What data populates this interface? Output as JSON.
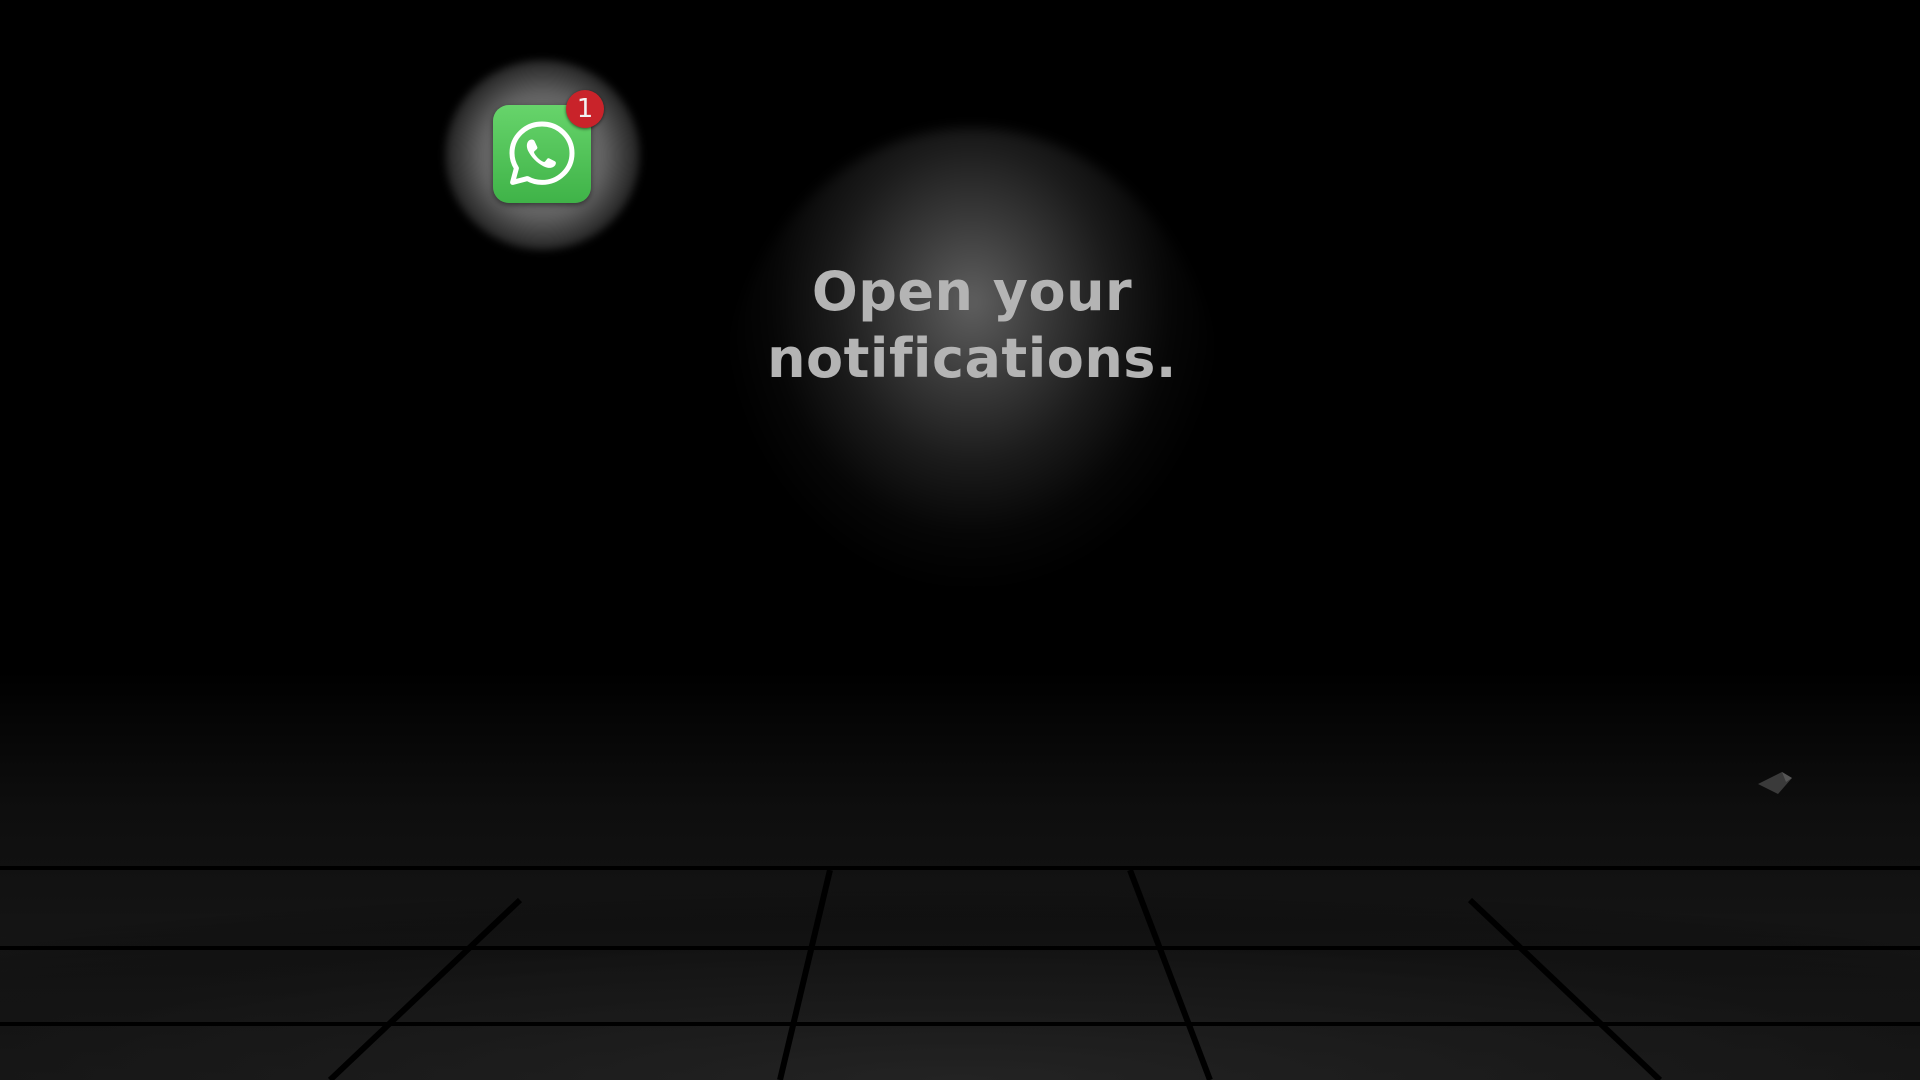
{
  "message": {
    "line1": "Open your",
    "line2": "notifications."
  },
  "app_icon": {
    "icon": "whatsapp-icon",
    "badge_count": "1",
    "colors": {
      "icon_bg": "#4cc254",
      "badge_bg": "#c9232a"
    }
  },
  "colors": {
    "background": "#000000",
    "text": "#b4b4b4"
  }
}
